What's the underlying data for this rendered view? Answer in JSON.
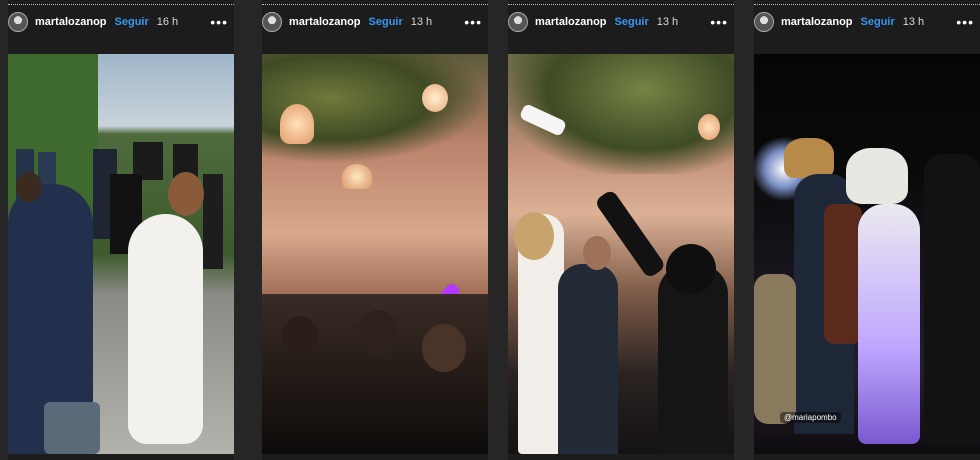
{
  "stories": [
    {
      "username": "martalozanop",
      "follow_label": "Seguir",
      "time": "16 h",
      "more": "•••",
      "mention": ""
    },
    {
      "username": "martalozanop",
      "follow_label": "Seguir",
      "time": "13 h",
      "more": "•••",
      "mention": ""
    },
    {
      "username": "martalozanop",
      "follow_label": "Seguir",
      "time": "13 h",
      "more": "•••",
      "mention": ""
    },
    {
      "username": "martalozanop",
      "follow_label": "Seguir",
      "time": "13 h",
      "more": "•••",
      "mention": "@mariapombo"
    }
  ],
  "colors": {
    "follow": "#3897f0",
    "background": "#262626"
  },
  "icons": {
    "avatar": "avatar",
    "more": "more-options-icon"
  }
}
